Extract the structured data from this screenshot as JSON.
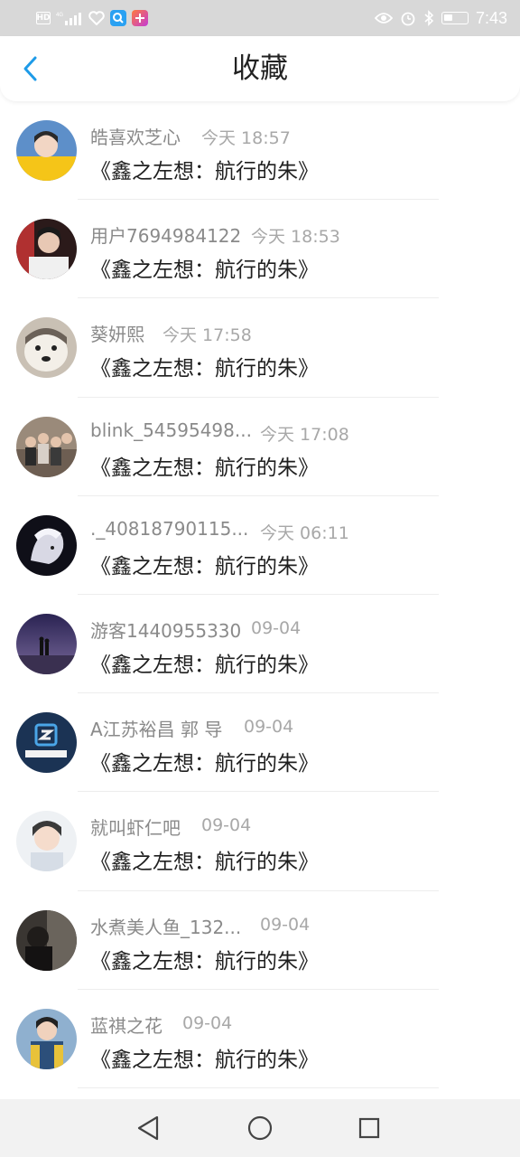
{
  "status_bar": {
    "network_label": "HD",
    "network_type": "4G",
    "time": "7:43",
    "icons": [
      "hd-icon",
      "signal-icon",
      "heart-icon",
      "search-app-icon",
      "app-icon",
      "eye-icon",
      "alarm-icon",
      "bluetooth-icon",
      "battery-icon"
    ]
  },
  "header": {
    "title": "收藏",
    "back_icon": "chevron-left-icon",
    "accent_color": "#1e9be8"
  },
  "items": [
    {
      "username": "皓喜欢芝心",
      "time": "今天 18:57",
      "title": "《鑫之左想：航行的朱》"
    },
    {
      "username": "用户7694984122",
      "time": "今天 18:53",
      "title": "《鑫之左想：航行的朱》"
    },
    {
      "username": "葵妍熙",
      "time": "今天 17:58",
      "title": "《鑫之左想：航行的朱》"
    },
    {
      "username": "blink_54595498...",
      "time": "今天 17:08",
      "title": "《鑫之左想：航行的朱》"
    },
    {
      "username": "._40818790115...",
      "time": "今天 06:11",
      "title": "《鑫之左想：航行的朱》"
    },
    {
      "username": "游客1440955330",
      "time": "09-04",
      "title": "《鑫之左想：航行的朱》"
    },
    {
      "username": "A江苏裕昌 郭 导",
      "time": "09-04",
      "title": "《鑫之左想：航行的朱》"
    },
    {
      "username": "就叫虾仁吧",
      "time": "09-04",
      "title": "《鑫之左想：航行的朱》"
    },
    {
      "username": "水煮美人鱼_132...",
      "time": "09-04",
      "title": "《鑫之左想：航行的朱》"
    },
    {
      "username": "蓝祺之花",
      "time": "09-04",
      "title": "《鑫之左想：航行的朱》"
    }
  ],
  "nav": {
    "back_icon": "triangle-back-icon",
    "home_icon": "circle-home-icon",
    "recents_icon": "square-recents-icon"
  }
}
